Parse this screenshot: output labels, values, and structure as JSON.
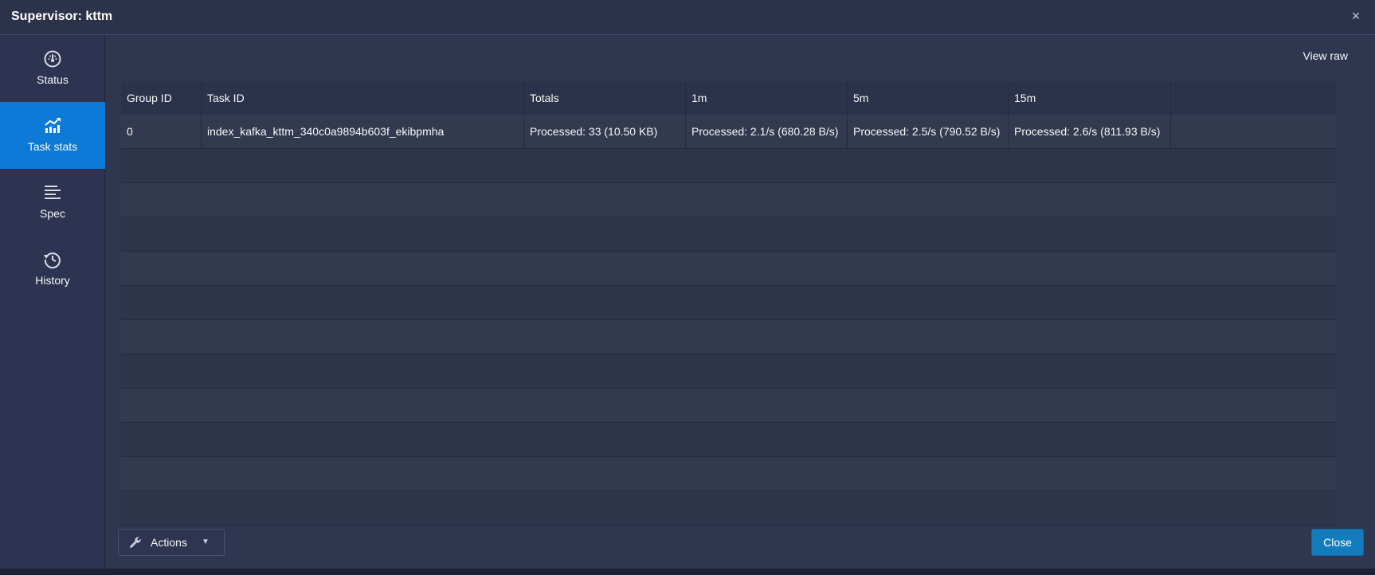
{
  "dialog": {
    "title": "Supervisor: kttm",
    "close_glyph": "×"
  },
  "sidebar": {
    "items": [
      {
        "label": "Status",
        "icon": "dashboard-icon",
        "active": false
      },
      {
        "label": "Task stats",
        "icon": "chart-trend-icon",
        "active": true
      },
      {
        "label": "Spec",
        "icon": "align-left-icon",
        "active": false
      },
      {
        "label": "History",
        "icon": "history-icon",
        "active": false
      }
    ]
  },
  "main": {
    "view_raw_label": "View raw",
    "table": {
      "columns": [
        "Group ID",
        "Task ID",
        "Totals",
        "1m",
        "5m",
        "15m"
      ],
      "rows": [
        {
          "group_id": "0",
          "task_id": "index_kafka_kttm_340c0a9894b603f_ekibpmha",
          "totals": "Processed: 33 (10.50 KB)",
          "m1": "Processed: 2.1/s (680.28 B/s)",
          "m5": "Processed: 2.5/s (790.52 B/s)",
          "m15": "Processed: 2.6/s (811.93 B/s)"
        }
      ]
    }
  },
  "footer": {
    "actions_label": "Actions",
    "close_label": "Close"
  },
  "colors": {
    "accent": "#0c7ad6",
    "background": "#30364f",
    "close_button": "#137cbd"
  }
}
